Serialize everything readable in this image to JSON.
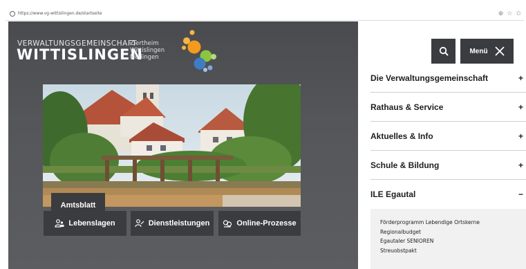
{
  "browser": {
    "url": "https://www.vg-wittislingen.de/startseite",
    "tools": [
      "⊕",
      "☆",
      "✩"
    ]
  },
  "logo": {
    "small": "VERWALTUNGSGEMEINSCHAFT",
    "big": "WITTISLINGEN",
    "towns": [
      "Ziertheim",
      "Wittislingen",
      "Mödingen"
    ]
  },
  "hero": {
    "amtsblatt_label": "Amtsblatt"
  },
  "quick_links": [
    {
      "label": "Lebenslagen",
      "icon": "people-icon"
    },
    {
      "label": "Dienstleistungen",
      "icon": "person-service-icon"
    },
    {
      "label": "Online-Prozesse",
      "icon": "online-process-icon"
    }
  ],
  "header": {
    "menu_label": "Menü"
  },
  "nav": {
    "items": [
      {
        "label": "Die Verwaltungsgemeinschaft",
        "sign": "+"
      },
      {
        "label": "Rathaus & Service",
        "sign": "+"
      },
      {
        "label": "Aktuelles & Info",
        "sign": "+"
      },
      {
        "label": "Schule & Bildung",
        "sign": "+"
      },
      {
        "label": "ILE Egautal",
        "sign": "−"
      }
    ],
    "subitems": [
      "Förderprogramm Lebendige Ortskerne",
      "Regionalbudget",
      "Egautaler SENIOREN",
      "Streuobstpakt"
    ]
  },
  "colors": {
    "dark_button": "#3b3c3f",
    "hero_background": "#55565a",
    "logo_orange": "#f39a1f",
    "logo_green": "#8cc63f",
    "logo_blue": "#3e7cc4"
  }
}
